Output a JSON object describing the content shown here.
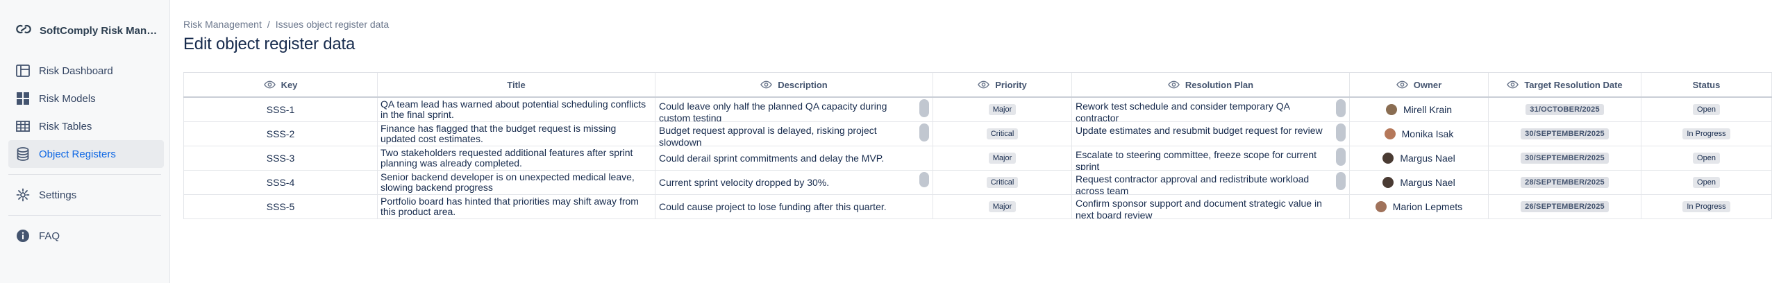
{
  "app": {
    "name": "SoftComply Risk Mana..."
  },
  "sidebar": {
    "items": [
      {
        "label": "Risk Dashboard",
        "icon": "dashboard-icon"
      },
      {
        "label": "Risk Models",
        "icon": "grid-icon"
      },
      {
        "label": "Risk Tables",
        "icon": "table-icon"
      },
      {
        "label": "Object Registers",
        "icon": "database-icon",
        "active": true
      }
    ],
    "settings": {
      "label": "Settings",
      "icon": "gear-icon"
    },
    "faq": {
      "label": "FAQ",
      "icon": "info-icon"
    }
  },
  "breadcrumb": {
    "root": "Risk Management",
    "separator": "/",
    "current": "Issues object register data"
  },
  "page": {
    "title": "Edit object register data"
  },
  "table": {
    "columns": {
      "key": "Key",
      "title": "Title",
      "description": "Description",
      "priority": "Priority",
      "resolution": "Resolution Plan",
      "owner": "Owner",
      "target": "Target Resolution Date",
      "status": "Status"
    },
    "rows": [
      {
        "key": "SSS-1",
        "title": "QA team lead has warned about potential scheduling conflicts in the final sprint.",
        "description": "Could leave only half the planned QA capacity during custom testing",
        "priority": "Major",
        "resolution": "Rework test schedule and consider temporary QA contractor",
        "owner": "Mirell Krain",
        "target": "31/OCTOBER/2025",
        "status": "Open"
      },
      {
        "key": "SSS-2",
        "title": "Finance has flagged that the budget request is missing updated cost estimates.",
        "description": "Budget request approval is delayed, risking project slowdown",
        "priority": "Critical",
        "resolution": "Update estimates and resubmit budget request for review",
        "owner": "Monika Isak",
        "target": "30/SEPTEMBER/2025",
        "status": "In Progress"
      },
      {
        "key": "SSS-3",
        "title": "Two stakeholders requested additional features after sprint planning was already completed.",
        "description": "Could derail sprint commitments and delay the MVP.",
        "priority": "Major",
        "resolution": "Escalate to steering committee, freeze scope for current sprint",
        "owner": "Margus Nael",
        "target": "30/SEPTEMBER/2025",
        "status": "Open"
      },
      {
        "key": "SSS-4",
        "title": "Senior backend developer is on unexpected medical leave, slowing backend progress",
        "description": "Current sprint velocity dropped by 30%.",
        "priority": "Critical",
        "resolution": "Request contractor approval and redistribute workload across team",
        "owner": "Margus Nael",
        "target": "28/SEPTEMBER/2025",
        "status": "Open"
      },
      {
        "key": "SSS-5",
        "title": "Portfolio board has hinted that priorities may shift away from this product area.",
        "description": "Could cause project to lose funding after this quarter.",
        "priority": "Major",
        "resolution": "Confirm sponsor support and document strategic value in next board review",
        "owner": "Marion Lepmets",
        "target": "26/SEPTEMBER/2025",
        "status": "In Progress"
      }
    ]
  }
}
